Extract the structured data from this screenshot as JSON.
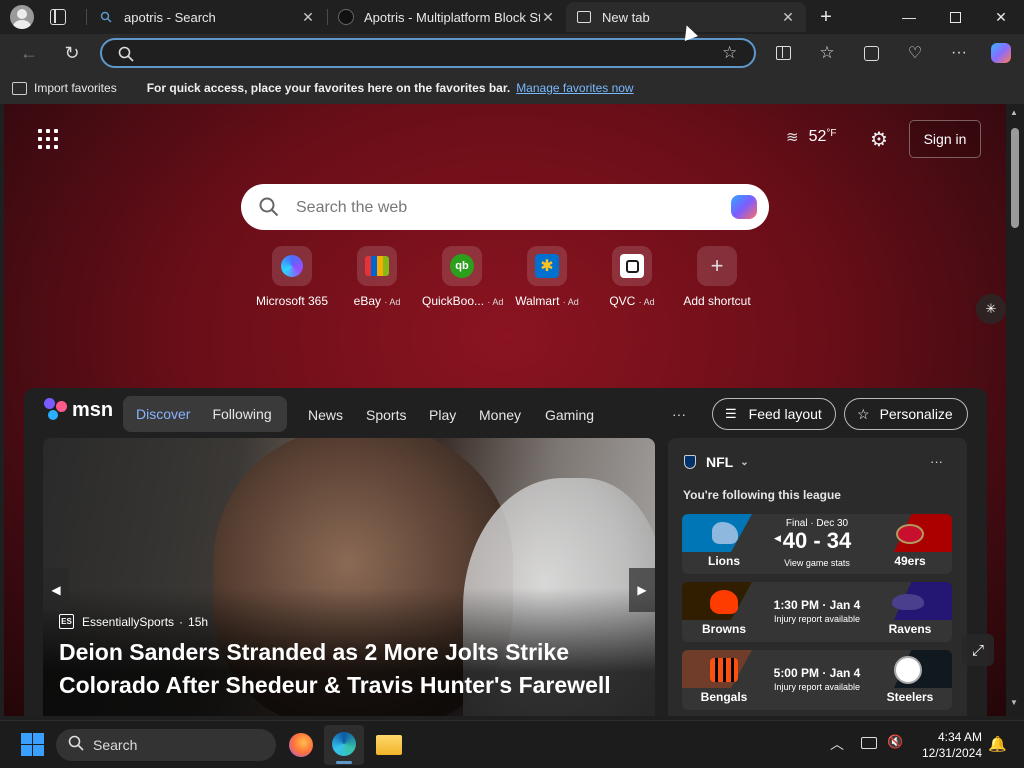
{
  "tabs": [
    {
      "title": "apotris - Search"
    },
    {
      "title": "Apotris - Multiplatform Block Stac"
    },
    {
      "title": "New tab"
    }
  ],
  "favbar": {
    "import_label": "Import favorites",
    "message": "For quick access, place your favorites here on the favorites bar.",
    "manage_link": "Manage favorites now"
  },
  "header": {
    "temperature": "52",
    "unit": "°F",
    "sign_in": "Sign in"
  },
  "search": {
    "placeholder": "Search the web"
  },
  "shortcuts": [
    {
      "label": "Microsoft 365",
      "ad": ""
    },
    {
      "label": "eBay",
      "ad": "· Ad"
    },
    {
      "label": "QuickBoo...",
      "ad": "· Ad"
    },
    {
      "label": "Walmart",
      "ad": "· Ad"
    },
    {
      "label": "QVC",
      "ad": "· Ad"
    },
    {
      "label": "Add shortcut",
      "ad": ""
    }
  ],
  "msn": {
    "logo": "msn",
    "nav": [
      "Discover",
      "Following",
      "News",
      "Sports",
      "Play",
      "Money",
      "Gaming"
    ],
    "more": "···",
    "feed_layout": "Feed layout",
    "personalize": "Personalize"
  },
  "hero": {
    "source": "EssentiallySports",
    "time": "15h",
    "headline_line1": "Deion Sanders Stranded as 2 More Jolts Strike",
    "headline_line2": "Colorado After Shedeur & Travis Hunter's Farewell"
  },
  "nfl": {
    "title": "NFL",
    "subtitle": "You're following this league",
    "more": "···",
    "games": [
      {
        "status": "Final · Dec 30",
        "score": "40 - 34",
        "note": "View game stats",
        "home": "Lions",
        "away": "49ers",
        "home_color": "#0076b6",
        "away_color": "#aa0000"
      },
      {
        "status": "1:30 PM · Jan 4",
        "score": "",
        "note": "Injury report available",
        "home": "Browns",
        "away": "Ravens",
        "home_color": "#311d00",
        "away_color": "#241773"
      },
      {
        "status": "5:00 PM · Jan 4",
        "score": "",
        "note": "Injury report available",
        "home": "Bengals",
        "away": "Steelers",
        "home_color": "#fb4f14",
        "away_color": "#101820"
      }
    ]
  },
  "taskbar": {
    "search": "Search",
    "time": "4:34 AM",
    "date": "12/31/2024"
  },
  "colors": {
    "accent": "#5e97c9",
    "link": "#79b8ff",
    "discover": "#8ab4ff"
  }
}
